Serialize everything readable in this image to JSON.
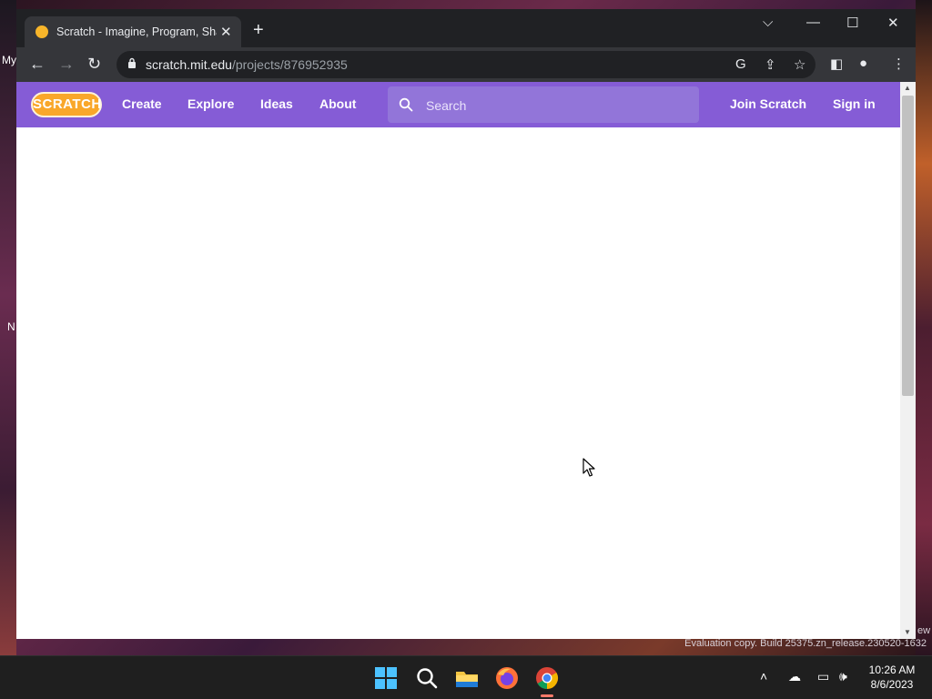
{
  "desktop": {
    "icon_label_my": "My",
    "icon_label_n": "N",
    "watermark": "Evaluation copy. Build 25375.zn_release.230520-1632",
    "watermark_edge": "ew"
  },
  "browser": {
    "tab": {
      "title": "Scratch - Imagine, Program, Share"
    },
    "toolbar": {
      "url_host": "scratch.mit.edu",
      "url_path": "/projects/876952935"
    }
  },
  "scratch": {
    "logo_text": "SCRATCH",
    "nav": {
      "create": "Create",
      "explore": "Explore",
      "ideas": "Ideas",
      "about": "About"
    },
    "search": {
      "placeholder": "Search"
    },
    "join": "Join Scratch",
    "signin": "Sign in",
    "brand_color": "#855cd6"
  },
  "taskbar": {
    "apps": [
      "start-icon",
      "search-icon",
      "file-explorer-icon",
      "firefox-icon",
      "chrome-icon"
    ],
    "active_app": "chrome-icon",
    "clock_time": "10:26 AM",
    "clock_date": "8/6/2023"
  }
}
